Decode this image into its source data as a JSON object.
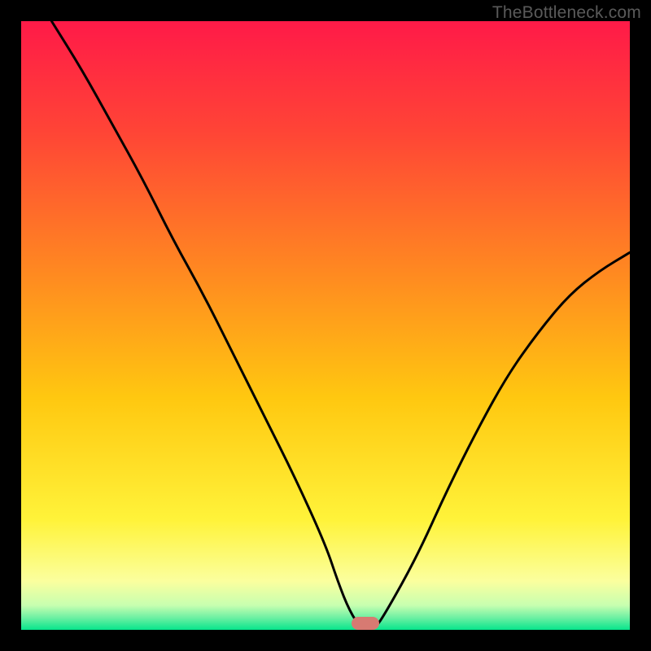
{
  "attribution": "TheBottleneck.com",
  "colors": {
    "gradient_stops": [
      "#ff1a48",
      "#ff4436",
      "#ff8b20",
      "#ffc810",
      "#fff33a",
      "#fbff9e",
      "#c7ffb0",
      "#6df0a3",
      "#07e58c"
    ],
    "curve": "#000000",
    "marker": "#d77a72",
    "bg": "#000000"
  },
  "chart_data": {
    "type": "line",
    "title": "",
    "xlabel": "",
    "ylabel": "",
    "xlim": [
      0,
      100
    ],
    "ylim": [
      0,
      100
    ],
    "x": [
      5,
      10,
      15,
      20,
      25,
      30,
      35,
      40,
      45,
      50,
      52,
      54,
      56,
      58,
      60,
      65,
      70,
      75,
      80,
      85,
      90,
      95,
      100
    ],
    "values": [
      100,
      92,
      83,
      74,
      64,
      55,
      45,
      35,
      25,
      14,
      8,
      3,
      0,
      0,
      3,
      12,
      23,
      33,
      42,
      49,
      55,
      59,
      62
    ],
    "marker": {
      "x": 56.5,
      "y": 0
    },
    "grid": false,
    "legend": false
  }
}
